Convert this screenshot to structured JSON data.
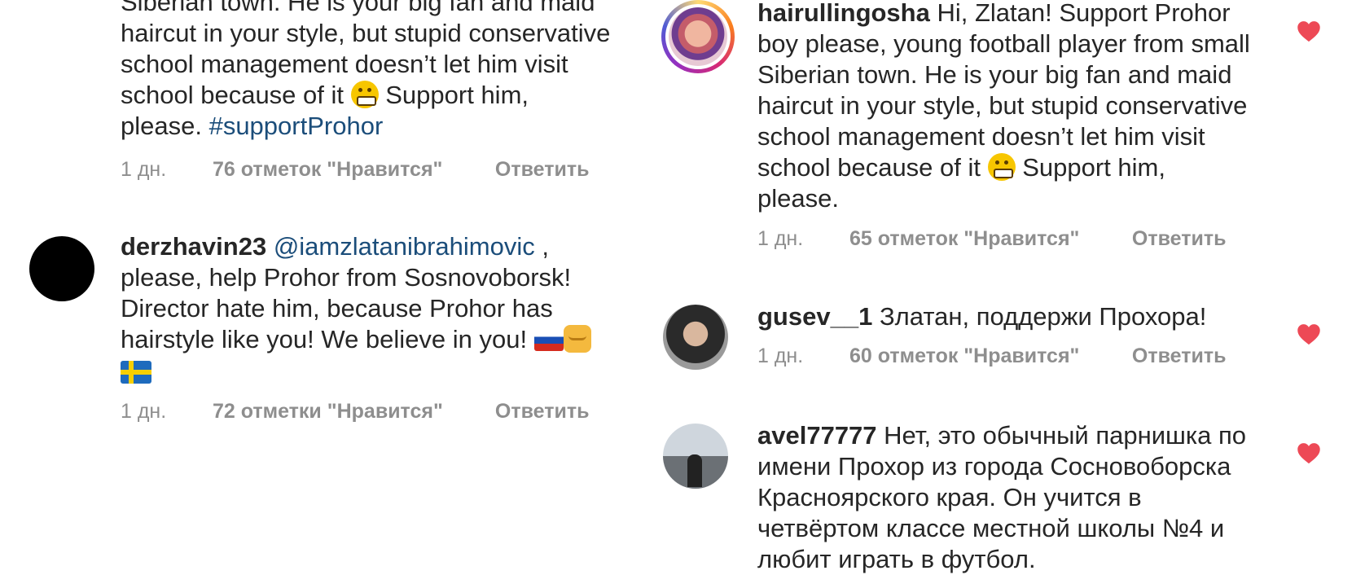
{
  "left_column": {
    "comment_top": {
      "text_lines": [
        "Siberian town. He is your big fan and maid",
        "haircut in your style, but stupid conservative",
        "school management doesn’t let him visit"
      ],
      "line4_before": "school because of it",
      "line4_after": " Support him,",
      "line5_text": "please. ",
      "hashtag": "#supportProhor",
      "time": "1 дн.",
      "likes": "76 отметок \"Нравится\"",
      "reply": "Ответить"
    },
    "comment_derzhavin": {
      "username": "derzhavin23",
      "mention": "@iamzlatanibrahimovic",
      "mention_after": " ,",
      "lines": [
        "please, help Prohor from Sosnovoborsk!",
        "Director hate him, because Prohor has"
      ],
      "line4": "hairstyle like you! We believe in you! ",
      "time": "1 дн.",
      "likes": "72 отметки \"Нравится\"",
      "reply": "Ответить"
    }
  },
  "right_column": {
    "comment_hairullingosha": {
      "username": "hairullingosha",
      "first_line": " Hi, Zlatan! Support Prohor",
      "lines": [
        "boy please, young football player from small",
        "Siberian town. He is your big fan and maid",
        "haircut in your style, but stupid conservative",
        "school management doesn’t let him visit"
      ],
      "line6_before": "school because of it ",
      "line6_after": " Support him,",
      "line7": "please.",
      "time": "1 дн.",
      "likes": "65 отметок \"Нравится\"",
      "reply": "Ответить"
    },
    "comment_gusev": {
      "username": "gusev__1",
      "text": " Златан, поддержи Прохора!",
      "time": "1 дн.",
      "likes": "60 отметок \"Нравится\"",
      "reply": "Ответить"
    },
    "comment_avel": {
      "username": "avel77777",
      "first_line": " Нет, это обычный парнишка по",
      "lines": [
        "имени Прохор из города Сосновоборска",
        "Красноярского края. Он учится в",
        "четвёртом классе местной школы №4 и",
        "любит играть в футбол."
      ]
    }
  },
  "colors": {
    "text": "#262626",
    "meta": "#8e8e8e",
    "link": "#1b4d7a",
    "heart": "#ed4956"
  }
}
